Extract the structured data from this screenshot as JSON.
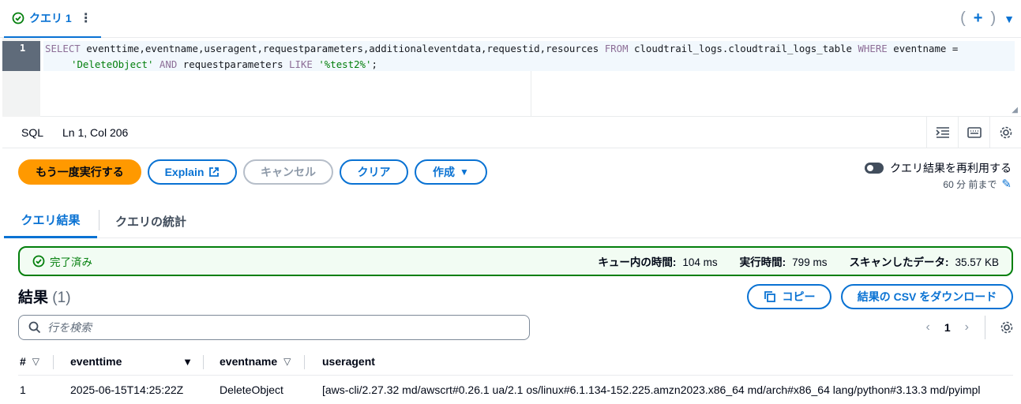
{
  "query_tab": {
    "label": "クエリ 1"
  },
  "editor": {
    "line_number": "1",
    "code": {
      "kw_select": "SELECT",
      "columns": " eventtime,eventname,useragent,requestparameters,additionaleventdata,requestid,resources ",
      "kw_from": "FROM",
      "table": " cloudtrail_logs.cloudtrail_logs_table ",
      "kw_where": "WHERE",
      "cond": " eventname =",
      "str1": "'DeleteObject'",
      "kw_and": " AND ",
      "col2": "requestparameters ",
      "kw_like": "LIKE",
      "str2": " '%test2%'",
      "end": ";"
    }
  },
  "status_bar": {
    "language": "SQL",
    "position": "Ln 1, Col 206"
  },
  "actions": {
    "run_again": "もう一度実行する",
    "explain": "Explain",
    "cancel": "キャンセル",
    "clear": "クリア",
    "create": "作成",
    "reuse_label": "クエリ結果を再利用する",
    "reuse_sub": "60 分 前まで"
  },
  "result_tabs": {
    "results": "クエリ結果",
    "stats": "クエリの統計"
  },
  "banner": {
    "status": "完了済み",
    "queue_label": "キュー内の時間:",
    "queue_value": "104 ms",
    "run_label": "実行時間:",
    "run_value": "799 ms",
    "scan_label": "スキャンしたデータ:",
    "scan_value": "35.57 KB"
  },
  "results": {
    "title": "結果",
    "count": "(1)",
    "copy": "コピー",
    "download": "結果の CSV をダウンロード",
    "search_placeholder": "行を検索",
    "page": "1"
  },
  "table": {
    "headers": {
      "index": "#",
      "eventtime": "eventtime",
      "eventname": "eventname",
      "useragent": "useragent"
    },
    "rows": [
      {
        "index": "1",
        "eventtime": "2025-06-15T14:25:22Z",
        "eventname": "DeleteObject",
        "useragent": "[aws-cli/2.27.32 md/awscrt#0.26.1 ua/2.1 os/linux#6.1.134-152.225.amzn2023.x86_64 md/arch#x86_64 lang/python#3.13.3 md/pyimpl"
      }
    ]
  },
  "colors": {
    "accent": "#0972d3",
    "primary_button": "#ff9900",
    "success": "#037f0c"
  }
}
